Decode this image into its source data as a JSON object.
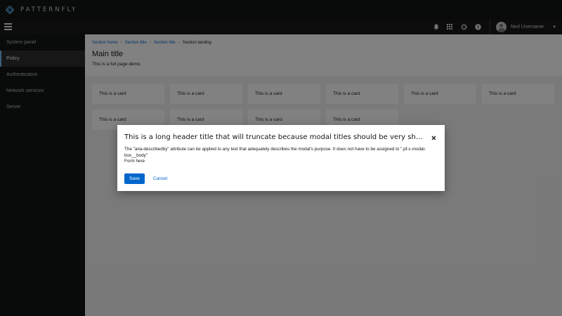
{
  "brand": {
    "name": "PATTERNFLY",
    "logo_icon": "patternfly-logo-icon"
  },
  "masthead": {
    "icons": [
      "bell-icon",
      "grid-icon",
      "gear-icon",
      "help-icon"
    ],
    "user": {
      "name": "Ned Username",
      "avatar_icon": "avatar-icon",
      "caret_icon": "caret-down-icon"
    }
  },
  "sidebar": {
    "items": [
      {
        "label": "System panel",
        "active": false
      },
      {
        "label": "Policy",
        "active": true
      },
      {
        "label": "Authentication",
        "active": false
      },
      {
        "label": "Network services",
        "active": false
      },
      {
        "label": "Server",
        "active": false
      }
    ]
  },
  "breadcrumb": {
    "items": [
      "Section home",
      "Section title",
      "Section title"
    ],
    "current": "Section landing",
    "separator": "›"
  },
  "page": {
    "title": "Main title",
    "description": "This is a full page demo."
  },
  "cards": [
    "This is a card",
    "This is a card",
    "This is a card",
    "This is a card",
    "This is a card",
    "This is a card",
    "This is a card",
    "This is a card",
    "This is a card",
    "This is a card"
  ],
  "modal": {
    "title": "This is a long header title that will truncate because modal titles should be very short. Use the modal body to provide more info.",
    "close_icon": "close-icon",
    "body_line1": "The \"aria-describedby\" attribute can be applied to any text that adequately describes the modal's purpose. It does not have to be assigned to \".pf-c-modal-box__body\"",
    "body_line2": "Form here",
    "save_label": "Save",
    "cancel_label": "Cancel"
  },
  "colors": {
    "primary": "#0066cc",
    "nav_active_border": "#73bcf7",
    "masthead_bg": "#141414",
    "sidebar_bg": "#0f1011"
  }
}
